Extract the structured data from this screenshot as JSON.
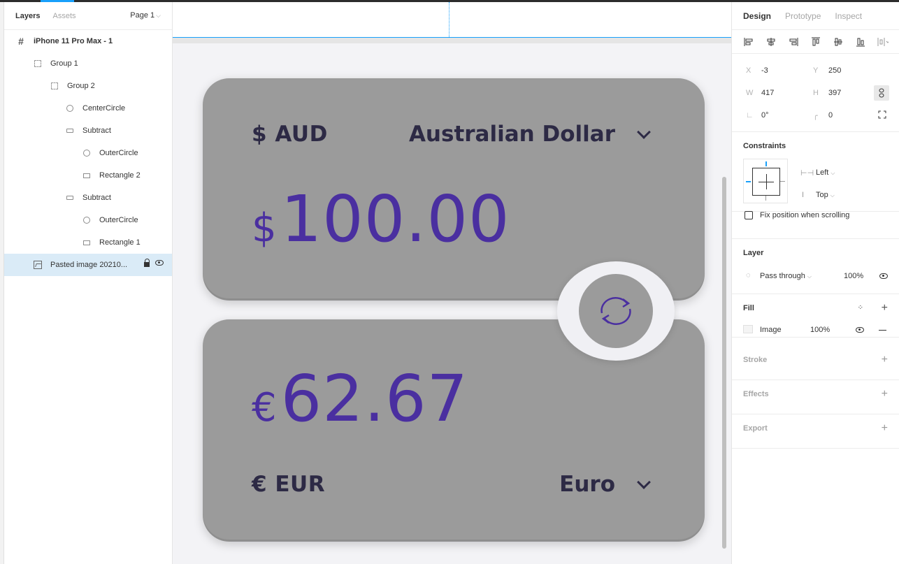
{
  "layers_panel": {
    "tabs": [
      "Layers",
      "Assets"
    ],
    "page_select": "Page 1",
    "layers": [
      {
        "name": "iPhone 11 Pro Max - 1",
        "icon": "frame-icon",
        "indent": 0
      },
      {
        "name": "Group 1",
        "icon": "group-icon",
        "indent": 1
      },
      {
        "name": "Group 2",
        "icon": "group-icon",
        "indent": 2
      },
      {
        "name": "CenterCircle",
        "icon": "ellipse-icon",
        "indent": 3
      },
      {
        "name": "Subtract",
        "icon": "subtract-icon",
        "indent": 3
      },
      {
        "name": "OuterCircle",
        "icon": "ellipse-icon",
        "indent": 4
      },
      {
        "name": "Rectangle 2",
        "icon": "rectangle-icon",
        "indent": 4
      },
      {
        "name": "Subtract",
        "icon": "subtract-icon",
        "indent": 3
      },
      {
        "name": "OuterCircle",
        "icon": "ellipse-icon",
        "indent": 4
      },
      {
        "name": "Rectangle 1",
        "icon": "rectangle-icon",
        "indent": 4
      },
      {
        "name": "Pasted image 20210...",
        "icon": "image-icon",
        "indent": 1,
        "selected": true
      }
    ]
  },
  "canvas": {
    "top_card": {
      "code": "$ AUD",
      "name": "Australian Dollar",
      "symbol": "$",
      "amount": "100.00"
    },
    "bottom_card": {
      "code": "€ EUR",
      "name": "Euro",
      "symbol": "€",
      "amount": "62.67"
    },
    "accent_color": "#4a2fa0",
    "card_color": "#9b9b9b"
  },
  "design_panel": {
    "tabs": [
      "Design",
      "Prototype",
      "Inspect"
    ],
    "x_label": "X",
    "x": "-3",
    "y_label": "Y",
    "y": "250",
    "w_label": "W",
    "w": "417",
    "h_label": "H",
    "h": "397",
    "rotation": "0°",
    "radius": "0",
    "constraints_title": "Constraints",
    "constraint_h": "Left",
    "constraint_v": "Top",
    "fix_position": "Fix position when scrolling",
    "layer_title": "Layer",
    "blend": "Pass through",
    "layer_opacity": "100%",
    "fill_title": "Fill",
    "fill_type": "Image",
    "fill_opacity": "100%",
    "stroke_title": "Stroke",
    "effects_title": "Effects",
    "export_title": "Export"
  }
}
